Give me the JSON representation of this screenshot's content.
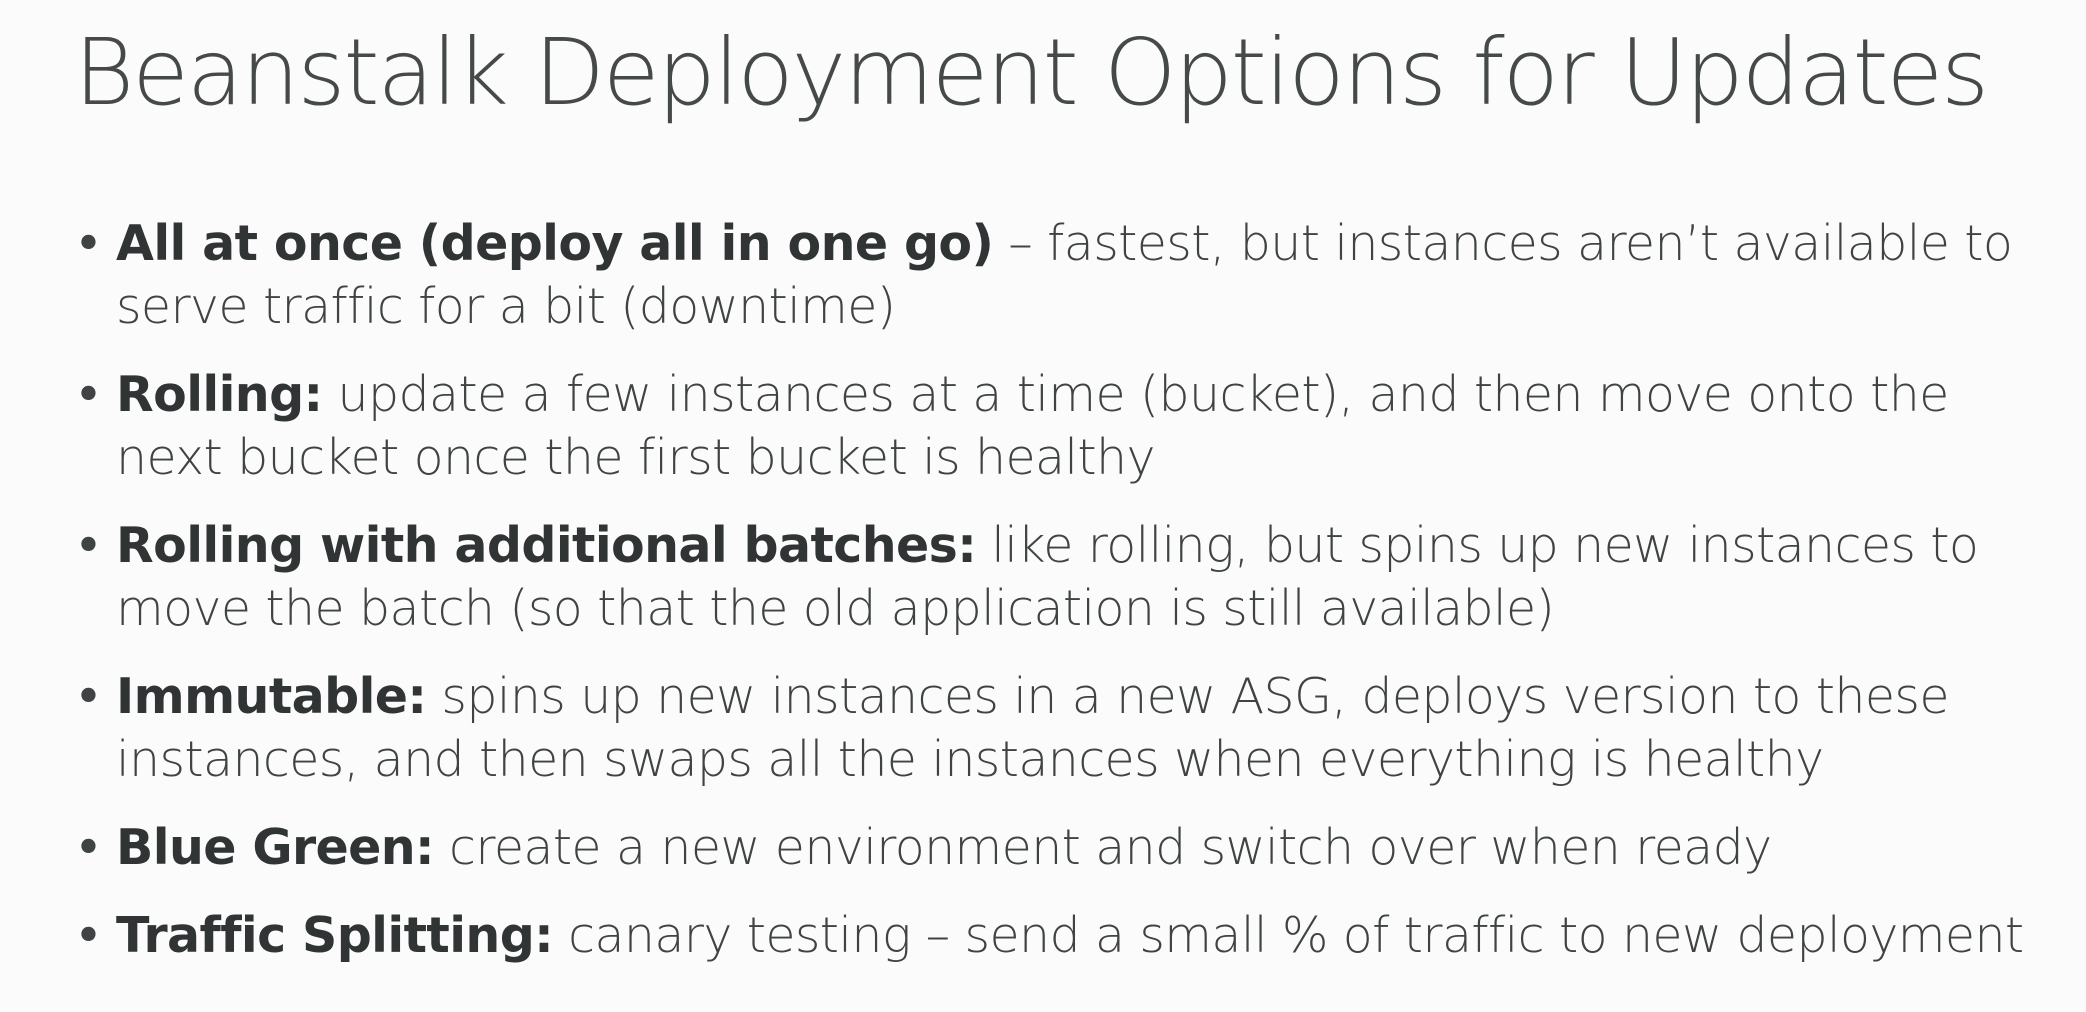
{
  "slide": {
    "title": "Beanstalk Deployment Options for Updates",
    "bullet_glyph": "•",
    "bullets": [
      {
        "term": "All at once (deploy all in one go)",
        "desc": " – fastest, but instances aren’t available to serve traffic for a bit (downtime)"
      },
      {
        "term": "Rolling:",
        "desc": " update a few instances at a time (bucket), and then move onto the next bucket once the first bucket is healthy"
      },
      {
        "term": "Rolling with additional batches:",
        "desc": " like rolling, but spins up new instances to move the batch (so that the old application is still available)"
      },
      {
        "term": "Immutable:",
        "desc": " spins up new instances in a new ASG, deploys version to these instances, and then swaps all the instances when everything is healthy"
      },
      {
        "term": "Blue Green:",
        "desc": " create a new environment and switch over when ready"
      },
      {
        "term": "Traffic Splitting:",
        "desc": " canary testing – send a small % of traffic to new deployment"
      }
    ]
  }
}
